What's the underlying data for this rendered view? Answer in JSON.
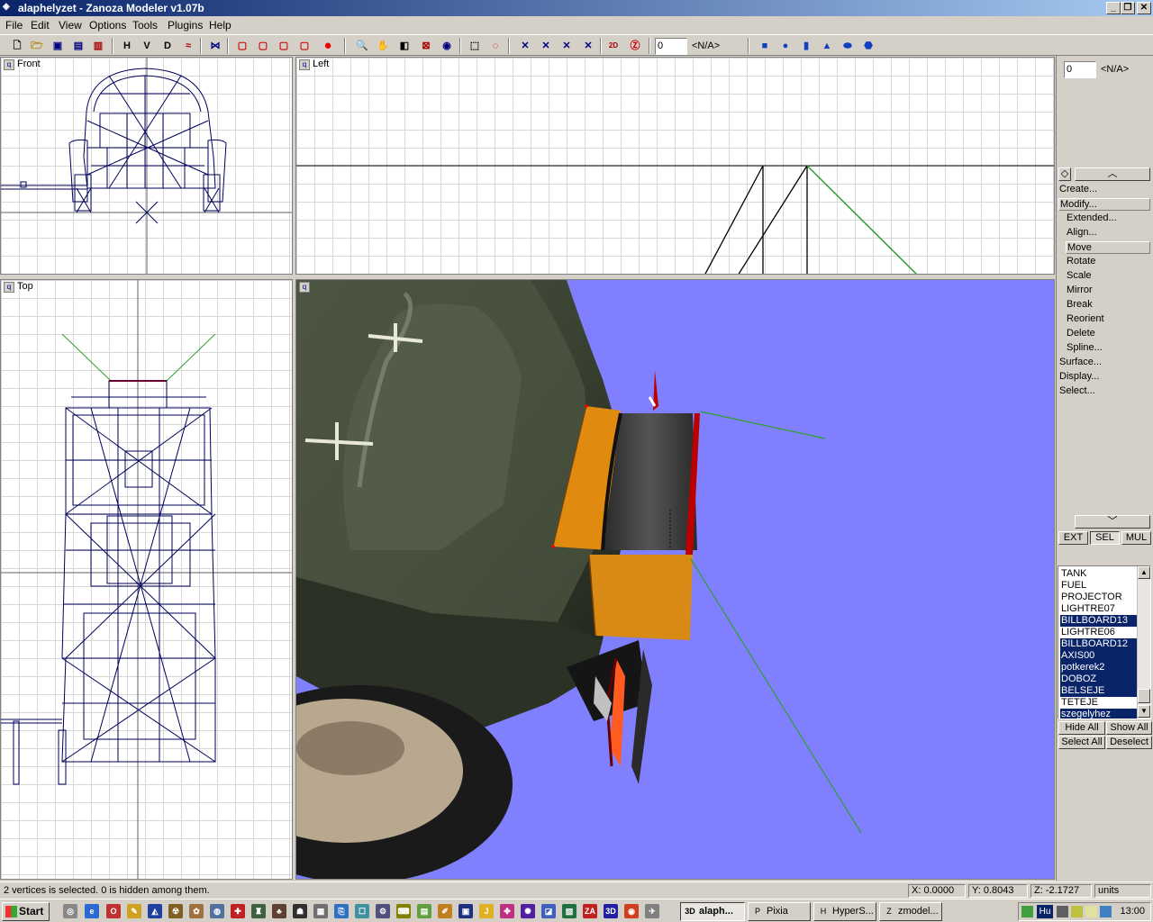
{
  "window": {
    "title": "alaphelyzet - Zanoza Modeler v1.07b",
    "app_icon": "zanoza-icon",
    "controls": {
      "minimize": "_",
      "maximize": "❐",
      "close": "✕"
    }
  },
  "menu": [
    "File",
    "Edit",
    "View",
    "Options",
    "Tools",
    "Plugins",
    "Help"
  ],
  "toolbar": {
    "letters": [
      "H",
      "V",
      "D"
    ],
    "spin1_value": "0",
    "spin1_text": "<N/A>"
  },
  "viewports": {
    "front": {
      "label": "Front"
    },
    "left": {
      "label": "Left"
    },
    "top": {
      "label": "Top"
    },
    "perspective": {
      "label": ""
    }
  },
  "panel": {
    "spin_value": "0",
    "spin_text": "<N/A>",
    "items": [
      {
        "label": "Create...",
        "level": 0,
        "selected": false
      },
      {
        "label": "Modify...",
        "level": 0,
        "selected": true
      },
      {
        "label": "Extended...",
        "level": 1,
        "selected": false
      },
      {
        "label": "Align...",
        "level": 1,
        "selected": false
      },
      {
        "label": "Move",
        "level": 1,
        "selected": true
      },
      {
        "label": "Rotate",
        "level": 1,
        "selected": false
      },
      {
        "label": "Scale",
        "level": 1,
        "selected": false
      },
      {
        "label": "Mirror",
        "level": 1,
        "selected": false
      },
      {
        "label": "Break",
        "level": 1,
        "selected": false
      },
      {
        "label": "Reorient",
        "level": 1,
        "selected": false
      },
      {
        "label": "Delete",
        "level": 1,
        "selected": false
      },
      {
        "label": "Spline...",
        "level": 1,
        "selected": false
      },
      {
        "label": "Surface...",
        "level": 0,
        "selected": false
      },
      {
        "label": "Display...",
        "level": 0,
        "selected": false
      },
      {
        "label": "Select...",
        "level": 0,
        "selected": false
      }
    ],
    "mode_tabs": [
      {
        "label": "EXT",
        "active": false
      },
      {
        "label": "SEL",
        "active": true
      },
      {
        "label": "MUL",
        "active": false
      }
    ],
    "objects": [
      {
        "name": "TANK",
        "selected": false
      },
      {
        "name": "FUEL",
        "selected": false
      },
      {
        "name": "PROJECTOR",
        "selected": false
      },
      {
        "name": "LIGHTRE07",
        "selected": false
      },
      {
        "name": "BILLBOARD13",
        "selected": true
      },
      {
        "name": "LIGHTRE06",
        "selected": false
      },
      {
        "name": "BILLBOARD12",
        "selected": true
      },
      {
        "name": "AXIS00",
        "selected": true
      },
      {
        "name": "potkerek2",
        "selected": true
      },
      {
        "name": "DOBOZ",
        "selected": true
      },
      {
        "name": "BELSEJE",
        "selected": true
      },
      {
        "name": "TETEJE",
        "selected": false
      },
      {
        "name": "szegelyhez",
        "selected": true
      }
    ],
    "buttons": {
      "hide_all": "Hide All",
      "show_all": "Show All",
      "select_all": "Select All",
      "deselect": "Deselect"
    }
  },
  "status": {
    "message": "2 vertices is selected. 0 is hidden among them.",
    "x": "X: 0.0000",
    "y": "Y: 0.8043",
    "z": "Z: -2.1727",
    "units": "units"
  },
  "taskbar": {
    "start": "Start",
    "tasks": [
      {
        "label": "alaph...",
        "icon": "3D",
        "active": true
      },
      {
        "label": "Pixia",
        "icon": "P",
        "active": false
      },
      {
        "label": "HyperS...",
        "icon": "H",
        "active": false
      },
      {
        "label": "zmodel...",
        "icon": "Z",
        "active": false
      }
    ],
    "lang": "Hu",
    "clock": "13:00"
  },
  "colors": {
    "title_start": "#0a246a",
    "title_end": "#a6caf0",
    "wireframe": "#00005a",
    "perspective_bg": "#8080ff",
    "selection_red": "#cc0000",
    "guide_green": "#2e9e2e"
  }
}
